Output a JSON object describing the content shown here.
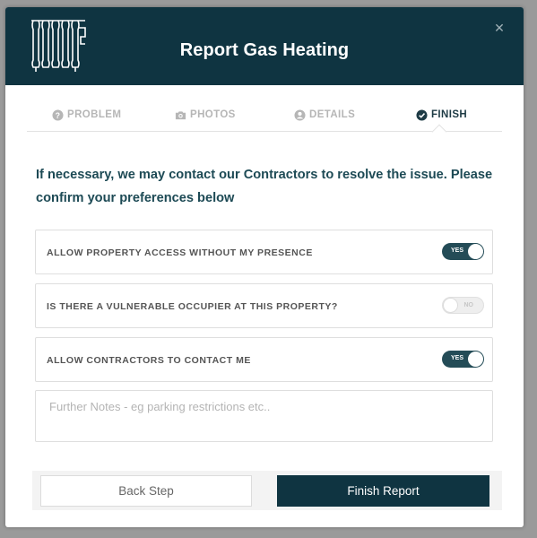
{
  "modal": {
    "title": "Report Gas Heating",
    "close_icon": "close-icon",
    "logo_icon": "radiator-icon"
  },
  "steps": [
    {
      "label": "PROBLEM",
      "icon": "question-circle-icon",
      "active": false
    },
    {
      "label": "PHOTOS",
      "icon": "camera-icon",
      "active": false
    },
    {
      "label": "DETAILS",
      "icon": "user-circle-icon",
      "active": false
    },
    {
      "label": "FINISH",
      "icon": "check-circle-icon",
      "active": true
    }
  ],
  "intro_text": "If necessary, we may contact our Contractors to resolve the issue. Please confirm your preferences below",
  "preferences": [
    {
      "label": "ALLOW PROPERTY ACCESS WITHOUT MY PRESENCE",
      "toggle_text": "YES",
      "on": true
    },
    {
      "label": "IS THERE A VULNERABLE OCCUPIER AT THIS PROPERTY?",
      "toggle_text": "NO",
      "on": false
    },
    {
      "label": "ALLOW CONTRACTORS TO CONTACT ME",
      "toggle_text": "YES",
      "on": true
    }
  ],
  "notes": {
    "placeholder": "Further Notes - eg parking restrictions etc..",
    "value": ""
  },
  "buttons": {
    "back_label": "Back Step",
    "finish_label": "Finish Report"
  },
  "colors": {
    "header_bg": "#0f3441",
    "accent": "#244c57",
    "intro_text": "#1d4a55",
    "inactive_step": "#b6b6b6"
  }
}
